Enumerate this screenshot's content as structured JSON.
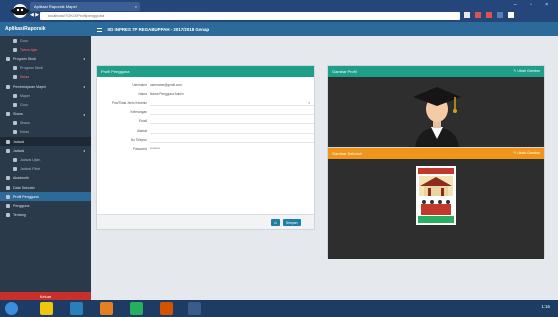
{
  "browser": {
    "tab_title": "Aplikasi Raporsik Mapel",
    "url": "localhost/TOKO/Profilpengguna",
    "window_controls": "– ▫ ×",
    "nav_icons": "◀ ▶ ⟳"
  },
  "sidebar": {
    "brand": "AplikasiRaporsik",
    "items": [
      {
        "label": "Guru",
        "sub": true
      },
      {
        "label": "Tahun Ajar",
        "sub": true,
        "red": true
      },
      {
        "label": "Program Studi",
        "arrow": "◂"
      },
      {
        "label": "Program Studi",
        "sub": true
      },
      {
        "label": "Kelas",
        "sub": true,
        "red": true
      },
      {
        "label": "Pembelajaran Mapel",
        "arrow": "◂"
      },
      {
        "label": "Mapel",
        "sub": true
      },
      {
        "label": "Guru",
        "sub": true
      },
      {
        "label": "Siswa",
        "arrow": "◂"
      },
      {
        "label": "Siswa",
        "sub": true
      },
      {
        "label": "Kelas",
        "sub": true
      },
      {
        "label": "Jadwal",
        "active": true
      },
      {
        "label": "Jadwal",
        "arrow": "◂"
      },
      {
        "label": "Jadwal Ujian",
        "sub": true
      },
      {
        "label": "Jadwal Piket",
        "sub": true
      },
      {
        "label": "Akademik"
      },
      {
        "label": "Data Sekolah"
      },
      {
        "label": "Profil Pengguna",
        "hl": true
      },
      {
        "label": "Pengguna"
      },
      {
        "label": "Tentang"
      }
    ],
    "exit_label": "Keluar"
  },
  "topbar": {
    "title": "SD INPRES 7P REGABUPPAH - 2017/2018 Genap"
  },
  "profile_form": {
    "header": "Profil Pengguna",
    "rows": [
      {
        "label": "Username",
        "value": "username@gmail.com"
      },
      {
        "label": "Nama",
        "value": "Nama Pengguna Admin"
      },
      {
        "label": "Pria/Tidak Jenis Kelamin",
        "value": "",
        "dropdown": true
      },
      {
        "label": "Keterangan",
        "value": ""
      },
      {
        "label": "Email",
        "value": ""
      },
      {
        "label": "Alamat",
        "value": ""
      },
      {
        "label": "No Telepon",
        "value": ""
      },
      {
        "label": "Password",
        "value": "********"
      }
    ],
    "icon_button_label": "⊙",
    "save_label": "Simpan"
  },
  "photo_card": {
    "header": "Gambar Profil",
    "edit_label": "✎ Ubah Gambar"
  },
  "logo_card": {
    "header": "Gambar Sekolah",
    "edit_label": "✎ Ubah Gambar",
    "school_name": "SD INPRES"
  },
  "taskbar": {
    "clock": "1:16"
  },
  "colors": {
    "primary": "#2c6a99",
    "teal": "#1f9e8a",
    "orange": "#f0951a",
    "sidebar": "#2a3a4a"
  }
}
